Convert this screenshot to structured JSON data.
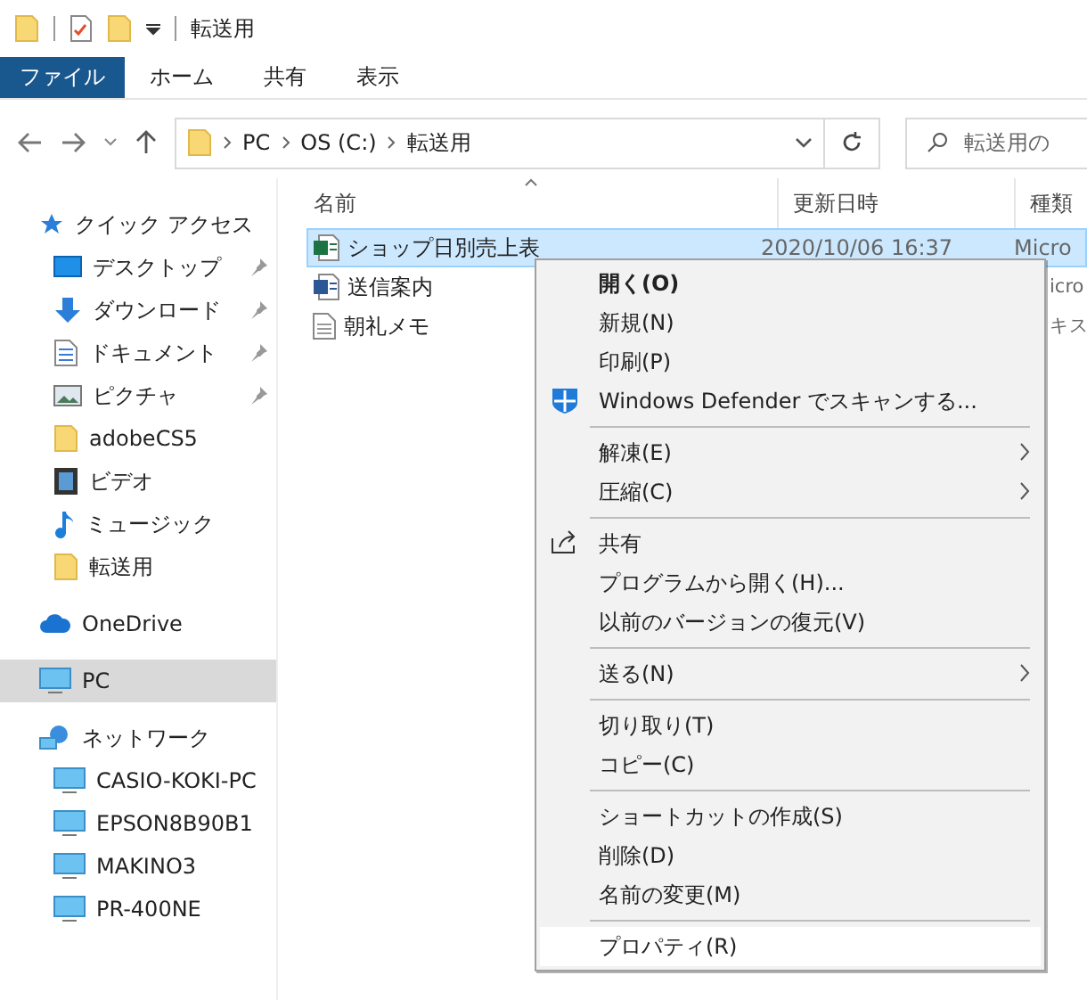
{
  "window": {
    "title": "転送用"
  },
  "ribbon_tabs": [
    {
      "label": "ファイル",
      "kind": "file"
    },
    {
      "label": "ホーム",
      "kind": "tab"
    },
    {
      "label": "共有",
      "kind": "tab"
    },
    {
      "label": "表示",
      "kind": "tab"
    }
  ],
  "address_bar": {
    "crumbs": [
      "PC",
      "OS (C:)",
      "転送用"
    ]
  },
  "search": {
    "placeholder": "転送用の"
  },
  "sidebar": {
    "items": [
      {
        "label": "クイック アクセス",
        "kind": "star",
        "selected": false,
        "children": [
          {
            "label": "デスクトップ",
            "kind": "desktop",
            "pinned": true,
            "selected": false
          },
          {
            "label": "ダウンロード",
            "kind": "download",
            "pinned": true,
            "selected": false
          },
          {
            "label": "ドキュメント",
            "kind": "document",
            "pinned": true,
            "selected": false
          },
          {
            "label": "ピクチャ",
            "kind": "pictures",
            "pinned": true,
            "selected": false
          },
          {
            "label": "adobeCS5",
            "kind": "folder",
            "pinned": false,
            "selected": false
          },
          {
            "label": "ビデオ",
            "kind": "video",
            "pinned": false,
            "selected": false
          },
          {
            "label": "ミュージック",
            "kind": "music",
            "pinned": false,
            "selected": false
          },
          {
            "label": "転送用",
            "kind": "folder",
            "pinned": false,
            "selected": false
          }
        ]
      },
      {
        "label": "OneDrive",
        "kind": "cloud",
        "selected": false
      },
      {
        "label": "PC",
        "kind": "monitor",
        "selected": true
      },
      {
        "label": "ネットワーク",
        "kind": "network",
        "selected": false,
        "children": [
          {
            "label": "CASIO-KOKI-PC",
            "kind": "monitor",
            "selected": false
          },
          {
            "label": "EPSON8B90B1",
            "kind": "monitor",
            "selected": false
          },
          {
            "label": "MAKINO3",
            "kind": "monitor",
            "selected": false
          },
          {
            "label": "PR-400NE",
            "kind": "monitor",
            "selected": false
          }
        ]
      }
    ]
  },
  "table": {
    "columns": [
      "名前",
      "更新日時",
      "種類"
    ],
    "rows": [
      {
        "name": "ショップ日別売上表",
        "kind": "excel",
        "modified": "2020/10/06 16:37",
        "type": "Micro",
        "selected": true
      },
      {
        "name": "送信案内",
        "kind": "word",
        "type": "icro",
        "selected": false
      },
      {
        "name": "朝礼メモ",
        "kind": "text",
        "type": "キス",
        "selected": false
      }
    ]
  },
  "context_menu": {
    "groups": [
      [
        {
          "label": "開く(O)",
          "bold": true,
          "submenu": false,
          "selected": false
        },
        {
          "label": "新規(N)",
          "bold": false,
          "submenu": false,
          "selected": false
        },
        {
          "label": "印刷(P)",
          "bold": false,
          "submenu": false,
          "selected": false
        },
        {
          "label": "Windows Defender でスキャンする...",
          "kind": "shield",
          "bold": false,
          "submenu": false,
          "selected": false
        }
      ],
      [
        {
          "label": "解凍(E)",
          "bold": false,
          "submenu": true,
          "selected": false
        },
        {
          "label": "圧縮(C)",
          "bold": false,
          "submenu": true,
          "selected": false
        }
      ],
      [
        {
          "label": "共有",
          "kind": "share",
          "bold": false,
          "submenu": false,
          "selected": false
        },
        {
          "label": "プログラムから開く(H)...",
          "bold": false,
          "submenu": false,
          "selected": false
        },
        {
          "label": "以前のバージョンの復元(V)",
          "bold": false,
          "submenu": false,
          "selected": false
        }
      ],
      [
        {
          "label": "送る(N)",
          "bold": false,
          "submenu": true,
          "selected": false
        }
      ],
      [
        {
          "label": "切り取り(T)",
          "bold": false,
          "submenu": false,
          "selected": false
        },
        {
          "label": "コピー(C)",
          "bold": false,
          "submenu": false,
          "selected": false
        }
      ],
      [
        {
          "label": "ショートカットの作成(S)",
          "bold": false,
          "submenu": false,
          "selected": false
        },
        {
          "label": "削除(D)",
          "bold": false,
          "submenu": false,
          "selected": false
        },
        {
          "label": "名前の変更(M)",
          "bold": false,
          "submenu": false,
          "selected": false
        }
      ],
      [
        {
          "label": "プロパティ(R)",
          "bold": false,
          "submenu": false,
          "selected": true
        }
      ]
    ]
  }
}
